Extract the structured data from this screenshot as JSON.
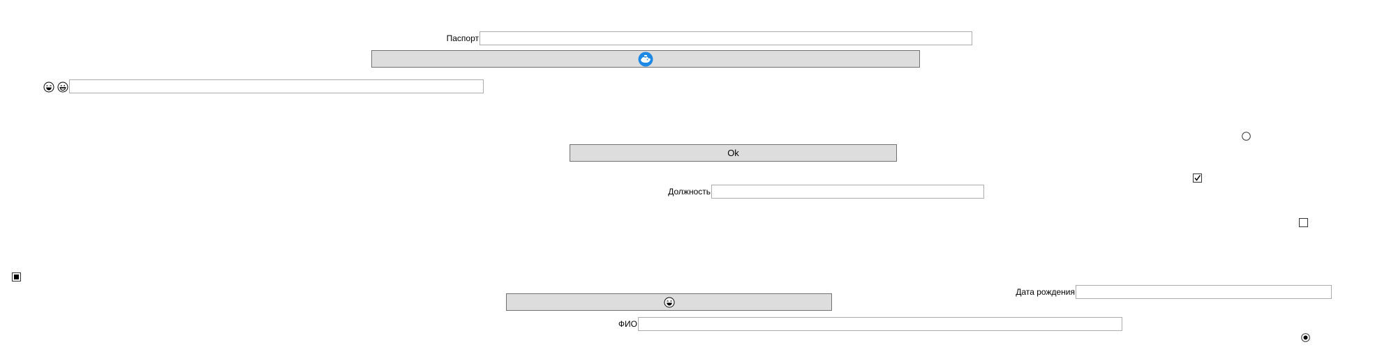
{
  "form": {
    "passport_label": "Паспорт",
    "position_label": "Должность",
    "birthdate_label": "Дата рождения",
    "fio_label": "ФИО",
    "ok_button_label": "Ok"
  },
  "icons": {
    "image_button_icon": "whale-logo-icon",
    "smiley_left": "laughing-face-icon",
    "smiley_right": "grinning-face-icon",
    "emoji_button_icon": "laughing-face-icon"
  },
  "states": {
    "checkbox_top_checked": true,
    "checkbox_right_checked": false,
    "checkbox_left_indeterminate": true,
    "radio_top_selected": false,
    "radio_bottom_selected": true
  },
  "colors": {
    "button_bg": "#dddddd",
    "field_border": "#ababab",
    "whale_blue": "#1e88e5"
  }
}
